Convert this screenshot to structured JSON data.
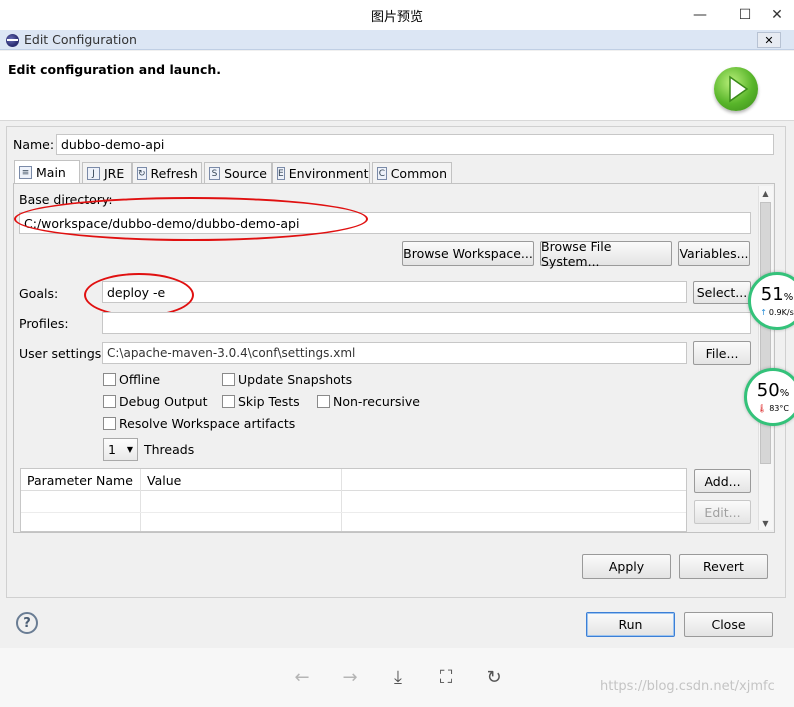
{
  "viewer": {
    "title": "图片预览",
    "minimize": "—",
    "maximize": "☐",
    "close": "✕",
    "watermark": "https://blog.csdn.net/xjmfc"
  },
  "dialog": {
    "title": "Edit Configuration",
    "close": "✕",
    "header": "Edit configuration and launch."
  },
  "form": {
    "name_label": "Name:",
    "name_value": "dubbo-demo-api",
    "tabs": [
      {
        "label": "Main",
        "icon": "main-tab-icon"
      },
      {
        "label": "JRE",
        "icon": "jre-icon"
      },
      {
        "label": "Refresh",
        "icon": "refresh-icon"
      },
      {
        "label": "Source",
        "icon": "source-icon"
      },
      {
        "label": "Environment",
        "icon": "environment-icon"
      },
      {
        "label": "Common",
        "icon": "common-icon"
      }
    ],
    "base_directory_label": "Base directory:",
    "base_directory_value": "C:/workspace/dubbo-demo/dubbo-demo-api",
    "browse_workspace": "Browse Workspace...",
    "browse_file_system": "Browse File System...",
    "variables": "Variables...",
    "goals_label": "Goals:",
    "goals_value": "deploy -e",
    "select": "Select...",
    "profiles_label": "Profiles:",
    "profiles_value": "",
    "user_settings_label": "User settings:",
    "user_settings_value": "C:\\apache-maven-3.0.4\\conf\\settings.xml",
    "file": "File...",
    "checkboxes": {
      "offline": "Offline",
      "update_snapshots": "Update Snapshots",
      "debug_output": "Debug Output",
      "skip_tests": "Skip Tests",
      "non_recursive": "Non-recursive",
      "resolve_workspace": "Resolve Workspace artifacts"
    },
    "threads_value": "1",
    "threads_label": "Threads",
    "table_headers": [
      "Parameter Name",
      "Value"
    ],
    "add": "Add...",
    "edit": "Edit...",
    "apply": "Apply",
    "revert": "Revert",
    "run": "Run",
    "close": "Close",
    "help": "?"
  },
  "monitor": {
    "cpu_value": "51",
    "cpu_unit": "%",
    "net_speed": "0.9K/s",
    "temp_value": "50",
    "temp_unit": "%",
    "temperature": "83°C"
  },
  "toolbar": {
    "prev": "←",
    "next": "→",
    "download": "⤓",
    "fit": "⛶",
    "rotate": "↻"
  },
  "colors": {
    "dialog_title_bg": "#dce6f4",
    "annotation_red": "#e01010",
    "monitor_green": "#34c27a",
    "run_button_border": "#3c7fd6"
  }
}
